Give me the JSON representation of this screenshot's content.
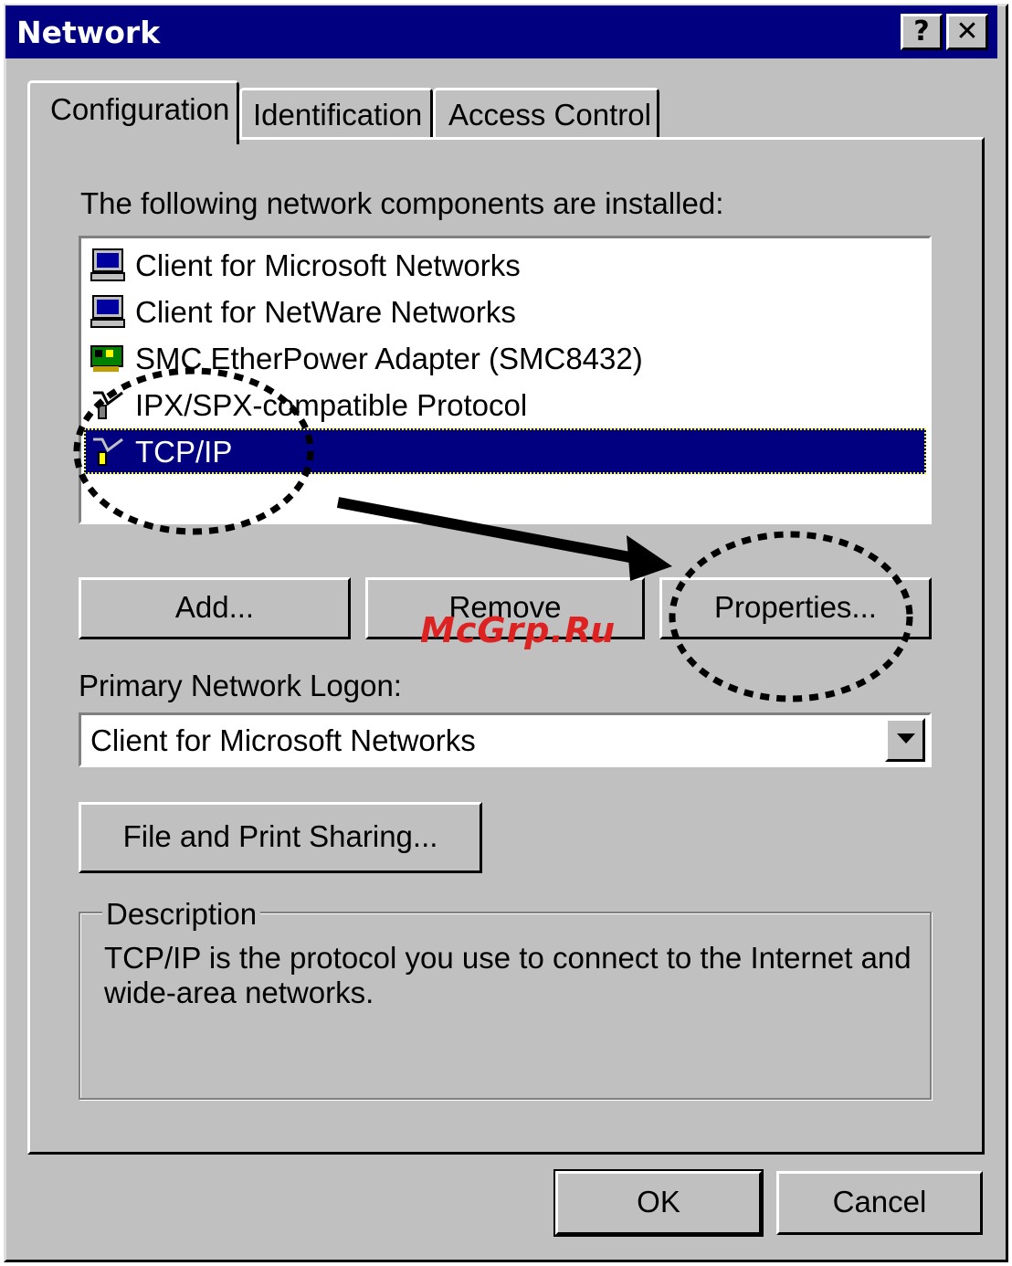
{
  "window": {
    "title": "Network",
    "help_button": "?",
    "close_button": "✕"
  },
  "tabs": [
    {
      "label": "Configuration",
      "active": true
    },
    {
      "label": "Identification",
      "active": false
    },
    {
      "label": "Access Control",
      "active": false
    }
  ],
  "components": {
    "heading": "The following network components are installed:",
    "items": [
      {
        "label": "Client for Microsoft Networks",
        "icon": "client-computer-icon"
      },
      {
        "label": "Client for NetWare Networks",
        "icon": "client-computer-icon"
      },
      {
        "label": "SMC EtherPower Adapter (SMC8432)",
        "icon": "network-adapter-icon"
      },
      {
        "label": "IPX/SPX-compatible Protocol",
        "icon": "protocol-cable-icon"
      },
      {
        "label": "TCP/IP",
        "icon": "protocol-cable-icon",
        "selected": true
      }
    ]
  },
  "buttons": {
    "add": "Add...",
    "remove": "Remove",
    "properties": "Properties...",
    "file_print_sharing": "File and Print Sharing...",
    "ok": "OK",
    "cancel": "Cancel"
  },
  "logon": {
    "label": "Primary Network Logon:",
    "value": "Client for Microsoft Networks"
  },
  "description": {
    "label": "Description",
    "text": "TCP/IP is the protocol you use to connect to the Internet and wide-area networks."
  },
  "watermark": "McGrp.Ru",
  "colors": {
    "titlebar": "#000080",
    "face": "#c0c0c0",
    "selection": "#000080"
  }
}
